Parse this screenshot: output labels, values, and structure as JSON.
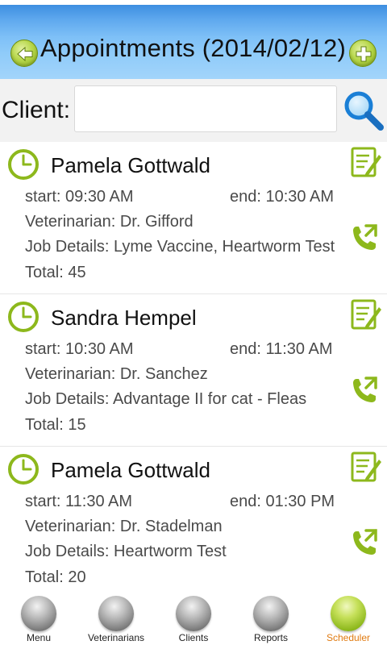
{
  "header": {
    "title": "Appointments (2014/02/12)",
    "back_icon": "back-arrow-icon",
    "add_icon": "plus-icon"
  },
  "search": {
    "label": "Client:",
    "value": "",
    "placeholder": "",
    "icon": "magnifier-icon"
  },
  "appointments": [
    {
      "client": "Pamela Gottwald",
      "start": "start: 09:30 AM",
      "end": "end: 10:30 AM",
      "veterinarian": "Veterinarian: Dr. Gifford",
      "job_details": "Job Details: Lyme Vaccine, Heartworm Test",
      "total": "Total: 45"
    },
    {
      "client": "Sandra Hempel",
      "start": "start: 10:30 AM",
      "end": "end: 11:30 AM",
      "veterinarian": "Veterinarian: Dr. Sanchez",
      "job_details": "Job Details: Advantage II for cat - Fleas",
      "total": "Total: 15"
    },
    {
      "client": "Pamela Gottwald",
      "start": "start: 11:30 AM",
      "end": "end: 01:30 PM",
      "veterinarian": "Veterinarian: Dr. Stadelman",
      "job_details": "Job Details: Heartworm Test",
      "total": "Total: 20"
    }
  ],
  "nav": {
    "items": [
      {
        "label": "Menu",
        "active": false
      },
      {
        "label": "Veterinarians",
        "active": false
      },
      {
        "label": "Clients",
        "active": false
      },
      {
        "label": "Reports",
        "active": false
      },
      {
        "label": "Scheduler",
        "active": true
      }
    ]
  },
  "colors": {
    "header_blue": "#5ea8ee",
    "accent_green": "#8bb21a",
    "active_tab": "#e07a10",
    "search_blue": "#1a7fd6"
  }
}
